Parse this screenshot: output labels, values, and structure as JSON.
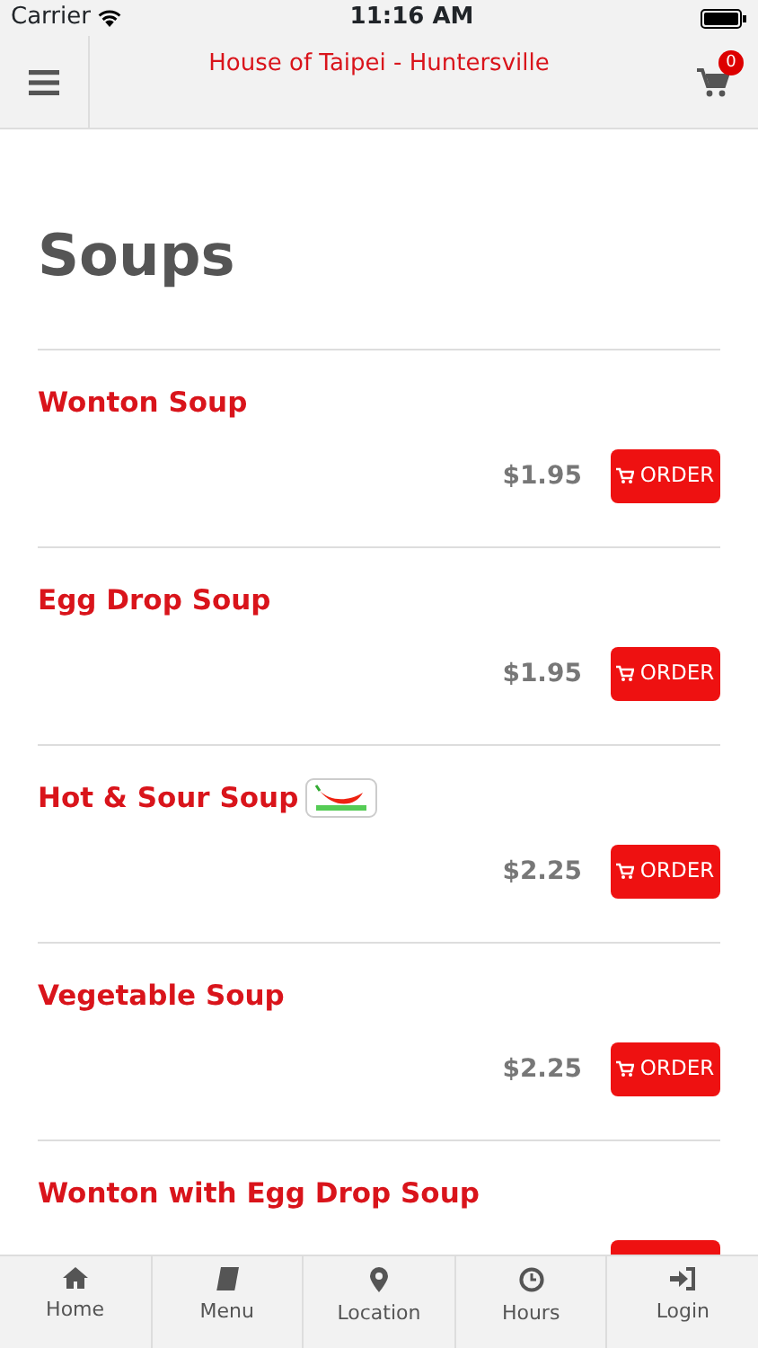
{
  "status_bar": {
    "carrier": "Carrier",
    "time": "11:16 AM"
  },
  "header": {
    "title": "House of Taipei - Huntersville",
    "cart_count": "0"
  },
  "section_title": "Soups",
  "items": [
    {
      "name": "Wonton Soup",
      "spicy": false,
      "price": "$1.95",
      "button": "ORDER",
      "cut": false
    },
    {
      "name": "Egg Drop Soup",
      "spicy": false,
      "price": "$1.95",
      "button": "ORDER",
      "cut": false
    },
    {
      "name": "Hot & Sour Soup",
      "spicy": true,
      "price": "$2.25",
      "button": "ORDER",
      "cut": false
    },
    {
      "name": "Vegetable Soup",
      "spicy": false,
      "price": "$2.25",
      "button": "ORDER",
      "cut": false
    },
    {
      "name": "Wonton with Egg Drop Soup",
      "spicy": false,
      "cut": true
    }
  ],
  "tabs": [
    {
      "label": "Home"
    },
    {
      "label": "Menu"
    },
    {
      "label": "Location"
    },
    {
      "label": "Hours"
    },
    {
      "label": "Login"
    }
  ]
}
